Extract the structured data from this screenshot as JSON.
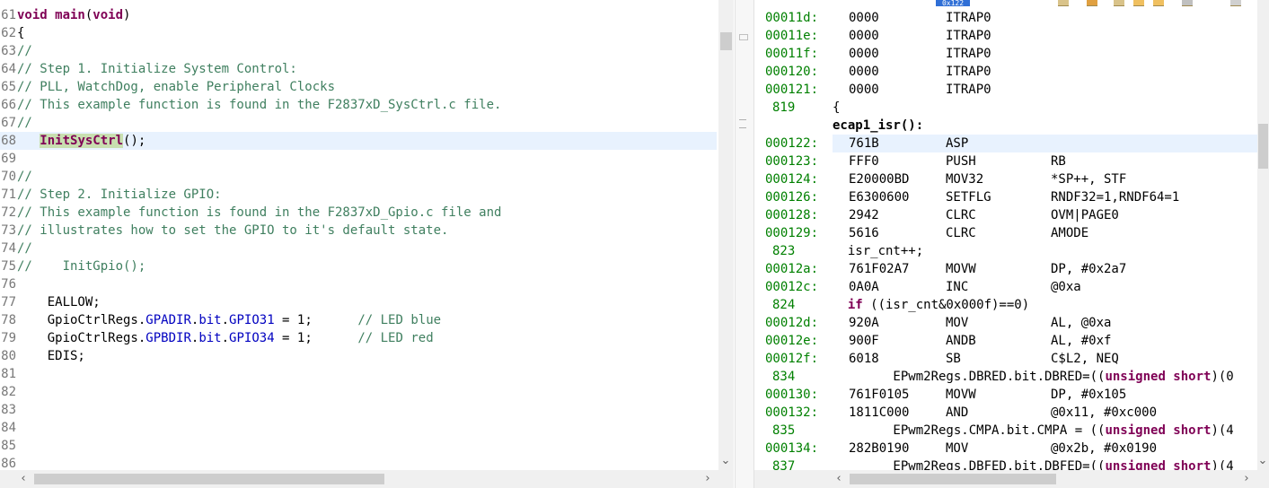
{
  "editor": {
    "lines": [
      {
        "num": "61",
        "parts": [
          {
            "t": "void main",
            "c": "kw"
          },
          {
            "t": "(",
            "c": ""
          },
          {
            "t": "void",
            "c": "kw"
          },
          {
            "t": ")",
            "c": ""
          }
        ]
      },
      {
        "num": "62",
        "parts": [
          {
            "t": "{",
            "c": ""
          }
        ]
      },
      {
        "num": "63",
        "parts": [
          {
            "t": "//",
            "c": "cmt"
          }
        ]
      },
      {
        "num": "64",
        "parts": [
          {
            "t": "// Step 1. Initialize System Control:",
            "c": "cmt"
          }
        ]
      },
      {
        "num": "65",
        "parts": [
          {
            "t": "// PLL, WatchDog, enable Peripheral Clocks",
            "c": "cmt"
          }
        ]
      },
      {
        "num": "66",
        "parts": [
          {
            "t": "// This example function is found in the F2837xD_SysCtrl.c file.",
            "c": "cmt"
          }
        ]
      },
      {
        "num": "67",
        "parts": [
          {
            "t": "//",
            "c": "cmt"
          }
        ]
      },
      {
        "num": "68",
        "parts": [
          {
            "t": "   ",
            "c": ""
          },
          {
            "t": "InitSysCtrl",
            "c": "hl-fn"
          },
          {
            "t": "();",
            "c": ""
          }
        ],
        "highlight": true
      },
      {
        "num": "69",
        "parts": []
      },
      {
        "num": "70",
        "parts": [
          {
            "t": "//",
            "c": "cmt"
          }
        ]
      },
      {
        "num": "71",
        "parts": [
          {
            "t": "// Step 2. Initialize GPIO:",
            "c": "cmt"
          }
        ]
      },
      {
        "num": "72",
        "parts": [
          {
            "t": "// This example function is found in the F2837xD_Gpio.c file and",
            "c": "cmt"
          }
        ]
      },
      {
        "num": "73",
        "parts": [
          {
            "t": "// illustrates how to set the GPIO to it's default state.",
            "c": "cmt"
          }
        ]
      },
      {
        "num": "74",
        "parts": [
          {
            "t": "//",
            "c": "cmt"
          }
        ]
      },
      {
        "num": "75",
        "parts": [
          {
            "t": "//    InitGpio();",
            "c": "cmt"
          }
        ]
      },
      {
        "num": "76",
        "parts": []
      },
      {
        "num": "77",
        "parts": [
          {
            "t": "    EALLOW;",
            "c": ""
          }
        ]
      },
      {
        "num": "78",
        "parts": [
          {
            "t": "    GpioCtrlRegs.",
            "c": ""
          },
          {
            "t": "GPADIR",
            "c": "fld"
          },
          {
            "t": ".",
            "c": ""
          },
          {
            "t": "bit",
            "c": "fld"
          },
          {
            "t": ".",
            "c": ""
          },
          {
            "t": "GPIO31",
            "c": "fld"
          },
          {
            "t": " = 1;      ",
            "c": ""
          },
          {
            "t": "// LED blue",
            "c": "cmt"
          }
        ]
      },
      {
        "num": "79",
        "parts": [
          {
            "t": "    GpioCtrlRegs.",
            "c": ""
          },
          {
            "t": "GPBDIR",
            "c": "fld"
          },
          {
            "t": ".",
            "c": ""
          },
          {
            "t": "bit",
            "c": "fld"
          },
          {
            "t": ".",
            "c": ""
          },
          {
            "t": "GPIO34",
            "c": "fld"
          },
          {
            "t": " = 1;      ",
            "c": ""
          },
          {
            "t": "// LED red",
            "c": "cmt"
          }
        ]
      },
      {
        "num": "80",
        "parts": [
          {
            "t": "    EDIS;",
            "c": ""
          }
        ]
      },
      {
        "num": "81",
        "parts": []
      },
      {
        "num": "82",
        "parts": []
      },
      {
        "num": "83",
        "parts": []
      },
      {
        "num": "84",
        "parts": []
      },
      {
        "num": "85",
        "parts": []
      },
      {
        "num": "86",
        "parts": []
      }
    ]
  },
  "disassembly": {
    "header_address": "0x122",
    "rows": [
      {
        "kind": "asm",
        "addr": "00011d:",
        "op": "0000",
        "mn": "ITRAP0",
        "args": ""
      },
      {
        "kind": "asm",
        "addr": "00011e:",
        "op": "0000",
        "mn": "ITRAP0",
        "args": ""
      },
      {
        "kind": "asm",
        "addr": "00011f:",
        "op": "0000",
        "mn": "ITRAP0",
        "args": ""
      },
      {
        "kind": "asm",
        "addr": "000120:",
        "op": "0000",
        "mn": "ITRAP0",
        "args": ""
      },
      {
        "kind": "asm",
        "addr": "000121:",
        "op": "0000",
        "mn": "ITRAP0",
        "args": ""
      },
      {
        "kind": "src",
        "num": "819",
        "text": "{"
      },
      {
        "kind": "label",
        "text": "ecap1_isr():"
      },
      {
        "kind": "asm",
        "addr": "000122:",
        "op": "761B",
        "mn": "ASP",
        "args": "",
        "highlight": true
      },
      {
        "kind": "asm",
        "addr": "000123:",
        "op": "FFF0",
        "mn": "PUSH",
        "args": "RB"
      },
      {
        "kind": "asm",
        "addr": "000124:",
        "op": "E20000BD",
        "mn": "MOV32",
        "args": "*SP++, STF"
      },
      {
        "kind": "asm",
        "addr": "000126:",
        "op": "E6300600",
        "mn": "SETFLG",
        "args": "RNDF32=1,RNDF64=1"
      },
      {
        "kind": "asm",
        "addr": "000128:",
        "op": "2942",
        "mn": "CLRC",
        "args": "OVM|PAGE0"
      },
      {
        "kind": "asm",
        "addr": "000129:",
        "op": "5616",
        "mn": "CLRC",
        "args": "AMODE"
      },
      {
        "kind": "src",
        "num": "823",
        "text": "  isr_cnt++;"
      },
      {
        "kind": "asm",
        "addr": "00012a:",
        "op": "761F02A7",
        "mn": "MOVW",
        "args": "DP, #0x2a7"
      },
      {
        "kind": "asm",
        "addr": "00012c:",
        "op": "0A0A",
        "mn": "INC",
        "args": "@0xa"
      },
      {
        "kind": "src",
        "num": "824",
        "text": "  if ((isr_cnt&0x000f)==0)",
        "kw": "if"
      },
      {
        "kind": "asm",
        "addr": "00012d:",
        "op": "920A",
        "mn": "MOV",
        "args": "AL, @0xa"
      },
      {
        "kind": "asm",
        "addr": "00012e:",
        "op": "900F",
        "mn": "ANDB",
        "args": "AL, #0xf"
      },
      {
        "kind": "asm",
        "addr": "00012f:",
        "op": "6018",
        "mn": "SB",
        "args": "C$L2, NEQ"
      },
      {
        "kind": "src",
        "num": "834",
        "text": "        EPwm2Regs.DBRED.bit.DBRED=((unsigned short)(0"
      },
      {
        "kind": "asm",
        "addr": "000130:",
        "op": "761F0105",
        "mn": "MOVW",
        "args": "DP, #0x105"
      },
      {
        "kind": "asm",
        "addr": "000132:",
        "op": "1811C000",
        "mn": "AND",
        "args": "@0x11, #0xc000"
      },
      {
        "kind": "src",
        "num": "835",
        "text": "        EPwm2Regs.CMPA.bit.CMPA = ((unsigned short)(4"
      },
      {
        "kind": "asm",
        "addr": "000134:",
        "op": "282B0190",
        "mn": "MOV",
        "args": "@0x2b, #0x0190"
      },
      {
        "kind": "src",
        "num": "837",
        "text": "        EPwm2Regs.DBFED.bit.DBFED=((unsigned short)(4"
      }
    ]
  },
  "colors": {
    "comment": "#3f7f5f",
    "keyword": "#7f0055",
    "field": "#0000c0",
    "address": "#008000",
    "line_highlight": "#e8f2fe",
    "breakpoint_fn": "#c8dfb0"
  }
}
